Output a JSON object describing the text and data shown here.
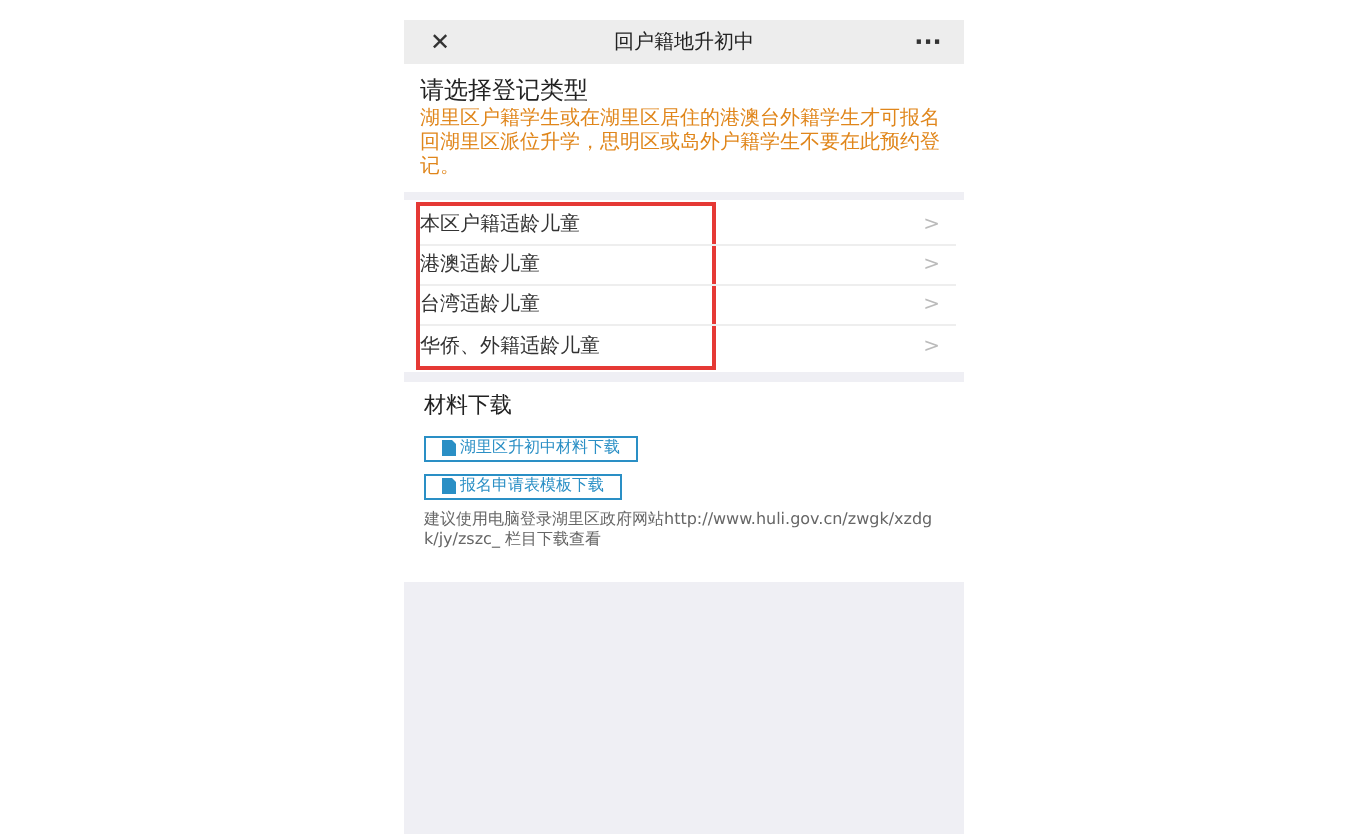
{
  "header": {
    "close": "✕",
    "title": "回户籍地升初中",
    "more": "···"
  },
  "section": {
    "title": "请选择登记类型",
    "notice": "湖里区户籍学生或在湖里区居住的港澳台外籍学生才可报名回湖里区派位升学，思明区或岛外户籍学生不要在此预约登记。"
  },
  "options": [
    {
      "label": "本区户籍适龄儿童",
      "chevron": ">"
    },
    {
      "label": "港澳适龄儿童",
      "chevron": ">"
    },
    {
      "label": "台湾适龄儿童",
      "chevron": ">"
    },
    {
      "label": "华侨、外籍适龄儿童",
      "chevron": ">"
    }
  ],
  "downloads": {
    "title": "材料下载",
    "buttons": [
      "湖里区升初中材料下载",
      "报名申请表模板下载"
    ],
    "hint": "建议使用电脑登录湖里区政府网站http://www.huli.gov.cn/zwgk/xzdgk/jy/zszc_ 栏目下载查看"
  }
}
